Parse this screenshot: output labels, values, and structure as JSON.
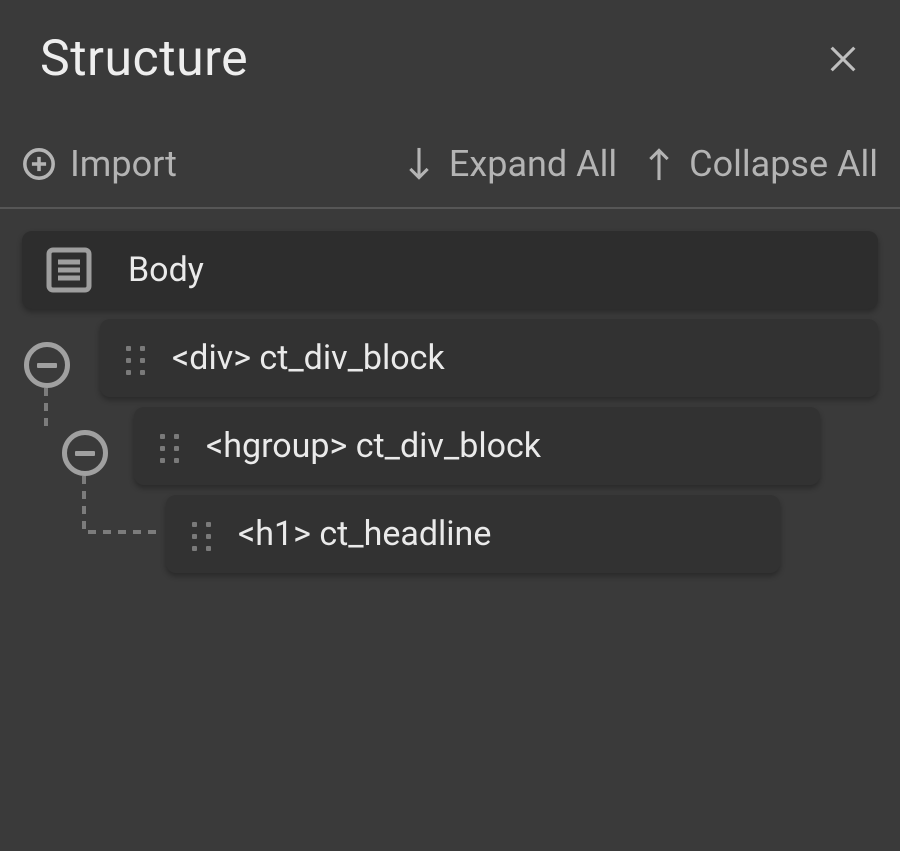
{
  "header": {
    "title": "Structure"
  },
  "toolbar": {
    "import_label": "Import",
    "expand_label": "Expand All",
    "collapse_label": "Collapse All"
  },
  "tree": {
    "body_label": "Body",
    "items": [
      {
        "label": "<div> ct_div_block"
      },
      {
        "label": "<hgroup> ct_div_block"
      },
      {
        "label": "<h1> ct_headline"
      }
    ]
  }
}
